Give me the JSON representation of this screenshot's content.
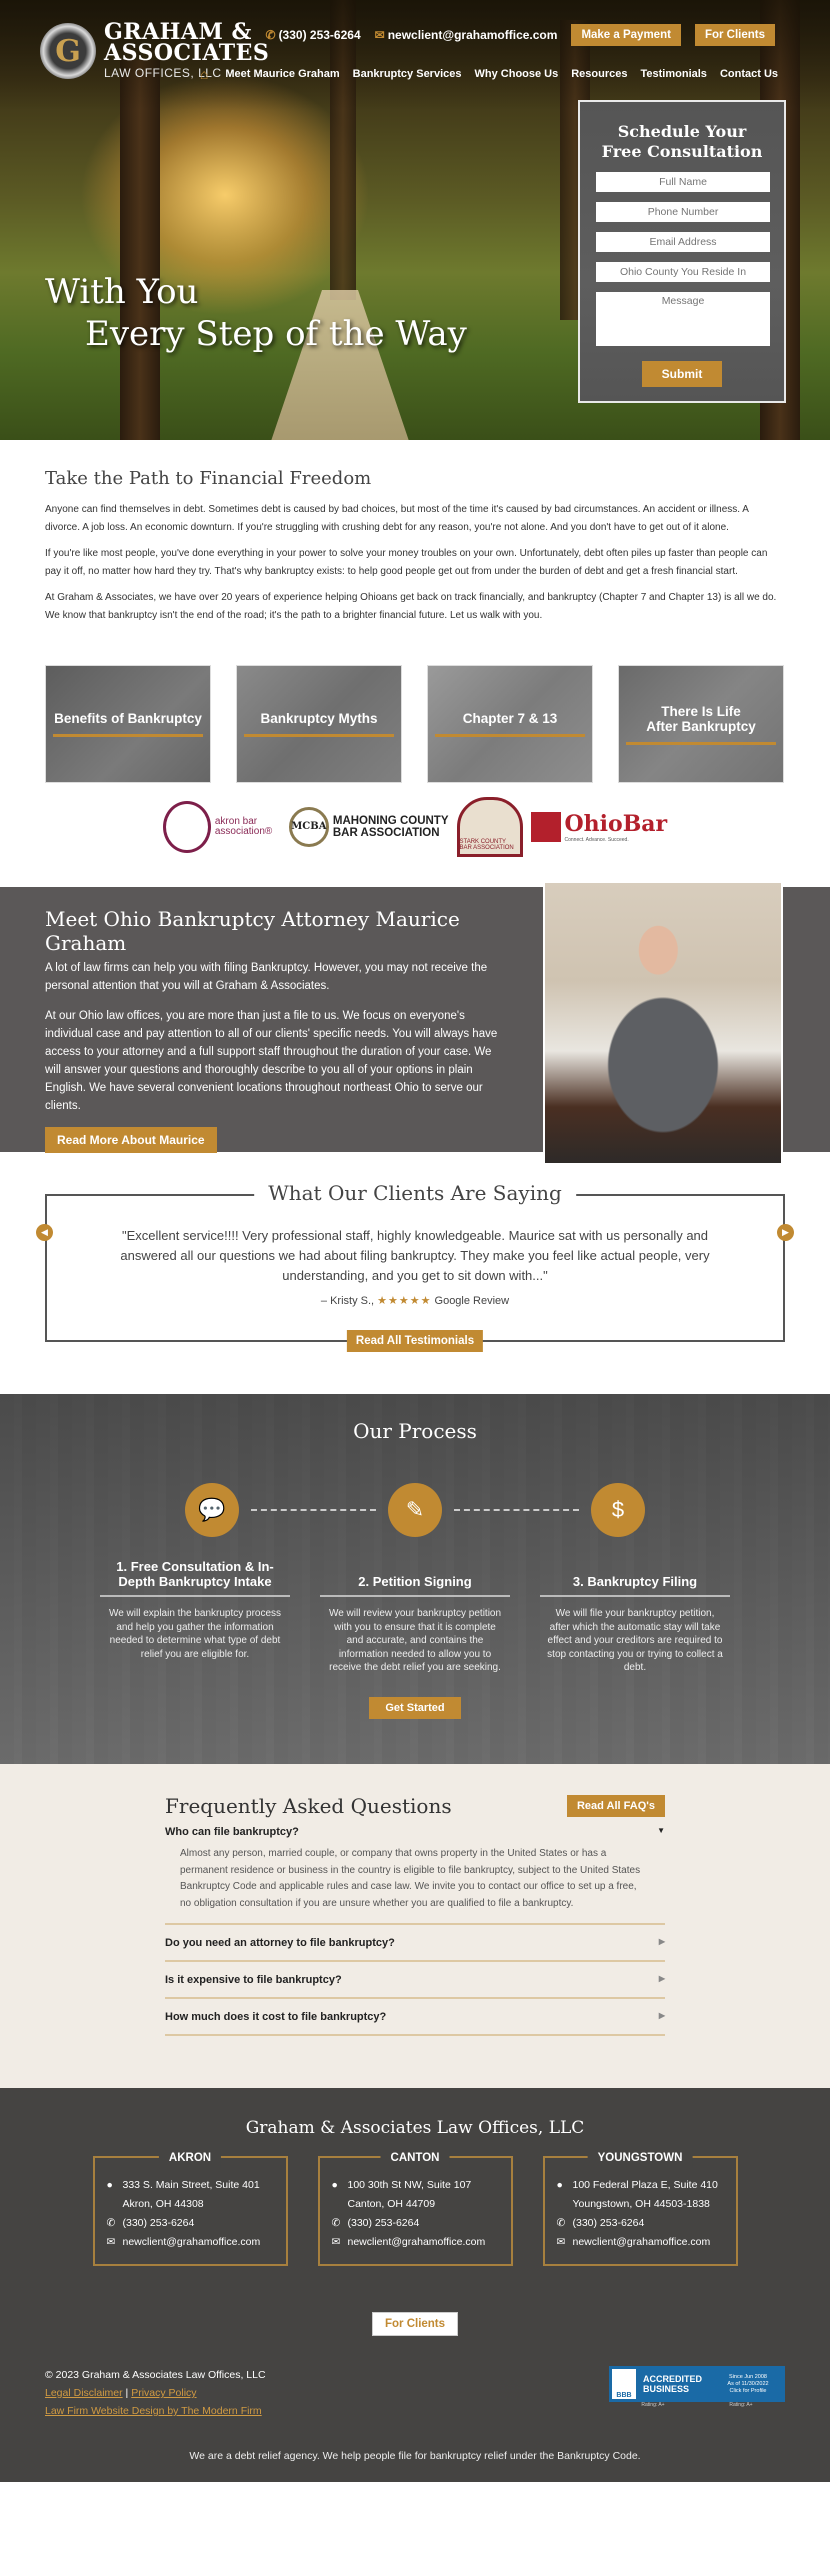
{
  "header": {
    "logo": {
      "line1": "GRAHAM &",
      "line2": "ASSOCIATES",
      "line3": "LAW OFFICES, LLC",
      "mark": "G"
    },
    "phone": "(330) 253-6264",
    "email": "newclient@grahamoffice.com",
    "buttons": {
      "payment": "Make a Payment",
      "clients": "For Clients"
    },
    "nav": [
      "Meet Maurice Graham",
      "Bankruptcy Services",
      "Why Choose Us",
      "Resources",
      "Testimonials",
      "Contact Us"
    ],
    "icons": {
      "phone": "phone-icon",
      "email": "envelope-icon",
      "home": "home-icon"
    }
  },
  "hero": {
    "tagline1": "With You",
    "tagline2": "Every Step of the Way"
  },
  "form": {
    "title": "Schedule Your Free Consultation",
    "fields": {
      "name": "Full Name",
      "phone": "Phone Number",
      "email": "Email Address",
      "county": "Ohio County You Reside In",
      "message": "Message"
    },
    "submit": "Submit"
  },
  "intro": {
    "title": "Take the Path to Financial Freedom",
    "paragraphs": [
      "Anyone can find themselves in debt. Sometimes debt is caused by bad choices, but most of the time it's caused by bad circumstances. An accident or illness. A divorce. A job loss. An economic downturn. If you're struggling with crushing debt for any reason, you're not alone. And you don't have to get out of it alone.",
      "If you're like most people, you've done everything in your power to solve your money troubles on your own. Unfortunately, debt often piles up faster than people can pay it off, no matter how hard they try. That's why bankruptcy exists: to help good people get out from under the burden of debt and get a fresh financial start.",
      "At Graham & Associates, we have over 20 years of experience helping Ohioans get back on track financially, and bankruptcy (Chapter 7 and Chapter 13) is all we do. We know that bankruptcy isn't the end of the road; it's the path to a brighter financial future. Let us walk with you."
    ]
  },
  "tiles": [
    "Benefits of Bankruptcy",
    "Bankruptcy Myths",
    "Chapter 7 & 13",
    "There Is Life After Bankruptcy"
  ],
  "badges": {
    "akron": "akron bar association®",
    "mahoning1": "MAHONING COUNTY",
    "mahoning2": "BAR ASSOCIATION",
    "mahoning_seal": "MCBA",
    "stark": "STARK COUNTY BAR ASSOCIATION",
    "ohio": "OhioBar",
    "ohio_sub": "Connect. Advance. Succeed."
  },
  "meet": {
    "title": "Meet Ohio Bankruptcy Attorney Maurice Graham",
    "p1": "A lot of law firms can help you with filing Bankruptcy. However, you may not receive the personal attention that you will at Graham & Associates.",
    "p2": "At our Ohio law offices, you are more than just a file to us. We focus on everyone's individual case and pay attention to all of our clients' specific needs. You will always have access to your attorney and a full support staff throughout the duration of your case. We will answer your questions and thoroughly describe to you all of your options in plain English. We have several convenient locations throughout northeast Ohio to serve our clients.",
    "button": "Read More About Maurice"
  },
  "testimonials": {
    "title": "What Our Clients Are Saying",
    "quote": "\"Excellent service!!!! Very professional staff, highly knowledgeable. Maurice sat with us personally and answered all our questions we had about filing bankruptcy. They make you feel like actual people, very understanding, and you get to sit down with...\"",
    "author": "– Kristy S.,",
    "stars": "★★★★★",
    "rating": 5,
    "source": "Google Review",
    "button": "Read All Testimonials"
  },
  "process": {
    "title": "Our Process",
    "steps": [
      {
        "title": "1. Free Consultation & In-Depth Bankruptcy Intake",
        "text": "We will explain the bankruptcy process and help you gather the information needed to determine what type of debt relief you are eligible for.",
        "icon": "chat-bubbles-icon"
      },
      {
        "title": "2. Petition Signing",
        "text": "We will review your bankruptcy petition with you to ensure that it is complete and accurate, and contains the information needed to allow you to receive the debt relief you are seeking.",
        "icon": "document-sign-icon"
      },
      {
        "title": "3. Bankruptcy Filing",
        "text": "We will file your bankruptcy petition, after which the automatic stay will take effect and your creditors are required to stop contacting you or trying to collect a debt.",
        "icon": "dollar-document-icon"
      }
    ],
    "button": "Get Started"
  },
  "faq": {
    "title": "Frequently Asked Questions",
    "button": "Read All FAQ's",
    "items": [
      {
        "q": "Who can file bankruptcy?",
        "a": "Almost any person, married couple, or company that owns property in the United States or has a permanent residence or business in the country is eligible to file bankruptcy, subject to the United States Bankruptcy Code and applicable rules and case law. We invite you to contact our office to set up a free, no obligation consultation if you are unsure whether you are qualified to file a bankruptcy.",
        "open": true
      },
      {
        "q": "Do you need an attorney to file bankruptcy?"
      },
      {
        "q": "Is it expensive to file bankruptcy?"
      },
      {
        "q": "How much does it cost to file bankruptcy?"
      }
    ]
  },
  "footer": {
    "title": "Graham & Associates Law Offices, LLC",
    "offices": [
      {
        "city": "AKRON",
        "addr1": "333 S. Main Street, Suite 401",
        "addr2": "Akron, OH 44308",
        "phone": "(330) 253-6264",
        "email": "newclient@grahamoffice.com"
      },
      {
        "city": "CANTON",
        "addr1": "100 30th St NW, Suite 107",
        "addr2": "Canton, OH 44709",
        "phone": "(330) 253-6264",
        "email": "newclient@grahamoffice.com"
      },
      {
        "city": "YOUNGSTOWN",
        "addr1": "100 Federal Plaza E, Suite 410",
        "addr2": "Youngstown, OH 44503-1838",
        "phone": "(330) 253-6264",
        "email": "newclient@grahamoffice.com"
      }
    ],
    "for_clients": "For Clients",
    "copyright": "© 2023 Graham & Associates Law Offices, LLC",
    "legal": "Legal Disclaimer",
    "privacy": "Privacy Policy",
    "sep": "|",
    "design": "Law Firm Website Design by The Modern Firm",
    "bbb": {
      "acc1": "ACCREDITED",
      "acc2": "BUSINESS",
      "since": "Since Jun 2008",
      "asof": "As of 11/30/2022",
      "click": "Click for Profile",
      "rating1": "Rating: A+",
      "rating2": "Rating: A+",
      "logo": "BBB"
    },
    "disclaimer": "We are a debt relief agency. We help people file for bankruptcy relief under the Bankruptcy Code."
  },
  "colors": {
    "accent": "#c18a32",
    "dark": "#5b5858",
    "footer": "#454442",
    "faq_bg": "#f1ece5"
  }
}
